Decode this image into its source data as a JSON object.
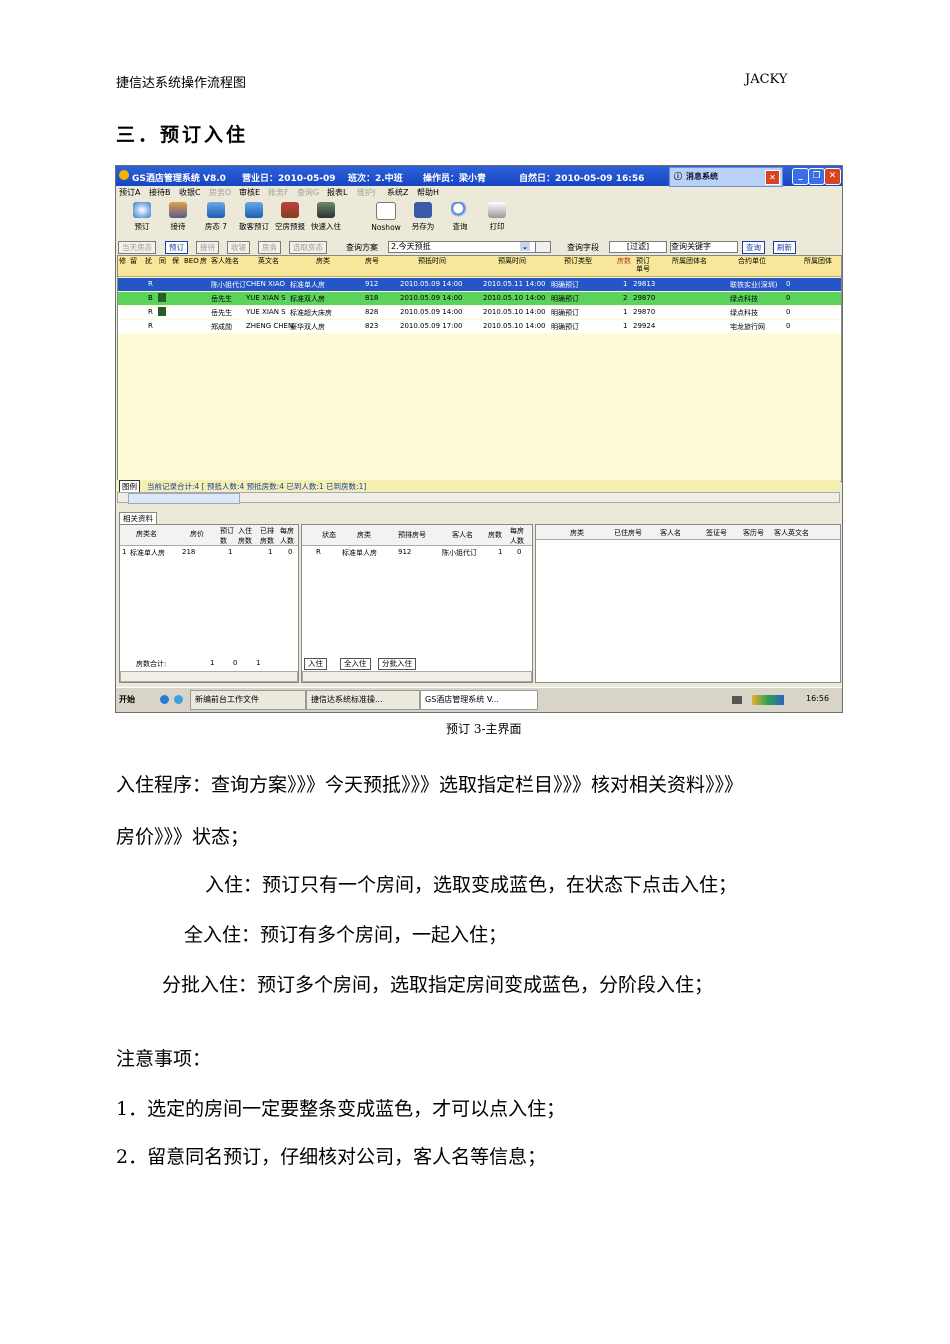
{
  "header": {
    "left": "捷信达系统操作流程图",
    "right": "JACKY"
  },
  "section_title": "三．预订入住",
  "app": {
    "title": "GS酒店管理系统 V8.0",
    "business_day": "营业日：2010-05-09",
    "shift": "班次：2.中班",
    "operator": "操作员：梁小青",
    "natural_day": "自然日：2010-05-09  16:56",
    "msg_tab": "消息系统",
    "menus": [
      "预订A",
      "接待B",
      "收银C",
      "房务D",
      "审核E",
      "账务F",
      "查询G",
      "报表L",
      "维护J",
      "系统Z",
      "帮助H"
    ],
    "tools": [
      "预订",
      "接待",
      "房态 7",
      "散客预订",
      "空房预报",
      "快速入住",
      "Noshow",
      "另存为",
      "查询",
      "打印"
    ],
    "tabs": [
      "当天房态",
      "预订",
      "接待",
      "收银",
      "房务",
      "选取房态"
    ],
    "query_label": "查询方案",
    "query_value": "2.今天预抵",
    "search_label": "查询字段",
    "search_mode": "[过滤]",
    "search_keyword": "查询关键字",
    "btn_query": "查询",
    "btn_refresh": "刷新",
    "grid_headers": [
      "修",
      "留",
      "扰",
      "同",
      "保",
      "BEO",
      "房",
      "客人姓名",
      "英文名",
      "房类",
      "房号",
      "预抵时间",
      "预离时间",
      "预订类型",
      "房数",
      "预订单号",
      "所属团体名",
      "合约单位",
      "所属团体"
    ],
    "rows": [
      {
        "name": "陈小姐代订",
        "en": "CHEN XIAO",
        "type": "标准单人房",
        "room": "912",
        "arr": "2010.05.09 14:00",
        "dep": "2010.05.11 14:00",
        "kind": "明确预订",
        "num": "1",
        "no": "29813",
        "co": "联铁实业(深圳)",
        "grp": "0"
      },
      {
        "name": "岳先生",
        "en": "YUE XIAN S",
        "type": "标准双人房",
        "room": "818",
        "arr": "2010.05.09 14:00",
        "dep": "2010.05.10 14:00",
        "kind": "明确预订",
        "num": "2",
        "no": "29870",
        "co": "绿点科技",
        "grp": "0"
      },
      {
        "name": "岳先生",
        "en": "YUE XIAN S",
        "type": "标准超大床房",
        "room": "828",
        "arr": "2010.05.09 14:00",
        "dep": "2010.05.10 14:00",
        "kind": "明确预订",
        "num": "1",
        "no": "29870",
        "co": "绿点科技",
        "grp": "0"
      },
      {
        "name": "郑成勋",
        "en": "ZHENG CHEN",
        "type": "豪华双人房",
        "room": "823",
        "arr": "2010.05.09 17:00",
        "dep": "2010.05.10 14:00",
        "kind": "明确预订",
        "num": "1",
        "no": "29924",
        "co": "宅龙旅行网",
        "grp": "0"
      }
    ],
    "summary": "当前记录合计:4  [ 预抵人数:4  预抵房数:4  已到人数:1  已到房数:1]",
    "summary_btn": "图例",
    "related_tab": "相关资料",
    "p1_headers": [
      "房类名",
      "房价",
      "预订数",
      "入住房数",
      "已排房数",
      "每房人数"
    ],
    "p1_row": [
      "标准单人房",
      "218",
      "1",
      "",
      "1",
      "0"
    ],
    "p1_total": [
      "房数合计:",
      "1",
      "0",
      "1"
    ],
    "p2_headers": [
      "状态",
      "房类",
      "预排房号",
      "客人名",
      "房数",
      "每房人数"
    ],
    "p2_row": [
      "R",
      "标准单人房",
      "912",
      "陈小姐代订",
      "1",
      "0"
    ],
    "p2_buttons": [
      "入住",
      "全入住",
      "分批入住"
    ],
    "p3_headers": [
      "房类",
      "已住房号",
      "客人名",
      "签证号",
      "客历号",
      "客人英文名"
    ],
    "taskbar": {
      "start": "开始",
      "items": [
        "新编前台工作文件",
        "捷信达系统标准操...",
        "GS酒店管理系统 V..."
      ],
      "clock": "16:56"
    }
  },
  "caption": "预订 3-主界面",
  "body": {
    "line1": "入住程序：查询方案》》》今天预抵》》》选取指定栏目》》》核对相关资料》》》",
    "line2": "房价》》》状态；",
    "item1": "入住：预订只有一个房间，选取变成蓝色，在状态下点击入住；",
    "item2": "全入住：预订有多个房间，一起入住；",
    "item3": "分批入住：预订多个房间，选取指定房间变成蓝色，分阶段入住；",
    "notes_title": "注意事项：",
    "note1": "1．选定的房间一定要整条变成蓝色，才可以点入住；",
    "note2": "2．留意同名预订，仔细核对公司，客人名等信息；"
  }
}
